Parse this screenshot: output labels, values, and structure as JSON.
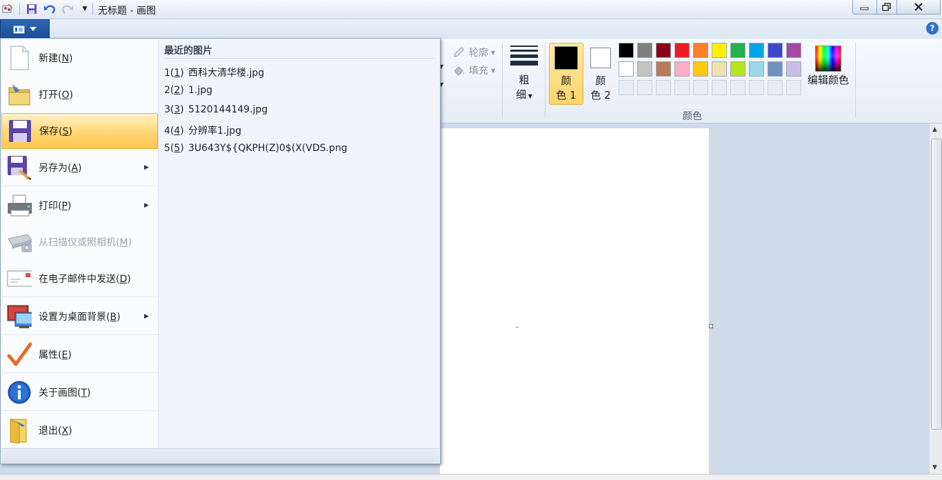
{
  "window": {
    "title": "无标题 - 画图"
  },
  "ribbon": {
    "outline_label": "轮廓",
    "fill_label": "填充",
    "size_label_1": "粗",
    "size_label_2": "细",
    "color1_label_1": "颜",
    "color1_label_2": "色 1",
    "color2_label_1": "颜",
    "color2_label_2": "色 2",
    "edit_colors_label": "编辑颜色",
    "colors_group_label": "颜色",
    "color1_value": "#000000",
    "color2_value": "#ffffff",
    "palette": [
      "#000000",
      "#7f7f7f",
      "#880015",
      "#ed1c24",
      "#ff7f27",
      "#fff200",
      "#22b14c",
      "#00a2e8",
      "#3f48cc",
      "#a349a4",
      "#ffffff",
      "#c3c3c3",
      "#b97a57",
      "#ffaec9",
      "#ffc90e",
      "#efe4b0",
      "#b5e61d",
      "#99d9ea",
      "#7092be",
      "#c8bfe7"
    ]
  },
  "menu": {
    "items": [
      {
        "label": "新建(",
        "key": "N",
        "tail": ")",
        "icon": "new-file-icon"
      },
      {
        "label": "打开(",
        "key": "O",
        "tail": ")",
        "icon": "open-folder-icon"
      },
      {
        "label": "保存(",
        "key": "S",
        "tail": ")",
        "icon": "save-icon"
      },
      {
        "label": "另存为(",
        "key": "A",
        "tail": ")",
        "icon": "save-as-icon"
      },
      {
        "label": "打印(",
        "key": "P",
        "tail": ")",
        "icon": "printer-icon"
      },
      {
        "label": "从扫描仪或照相机(",
        "key": "M",
        "tail": ")",
        "icon": "scanner-icon"
      },
      {
        "label": "在电子邮件中发送(",
        "key": "D",
        "tail": ")",
        "icon": "email-icon"
      },
      {
        "label": "设置为桌面背景(",
        "key": "B",
        "tail": ")",
        "icon": "desktop-background-icon"
      },
      {
        "label": "属性(",
        "key": "E",
        "tail": ")",
        "icon": "properties-check-icon"
      },
      {
        "label": "关于画图(",
        "key": "T",
        "tail": ")",
        "icon": "info-icon"
      },
      {
        "label": "退出(",
        "key": "X",
        "tail": ")",
        "icon": "exit-icon"
      }
    ],
    "recent_header": "最近的图片",
    "recent": [
      {
        "num_a": "1(",
        "num_key": "1",
        "num_b": ")",
        "name": "西科大清华楼.jpg"
      },
      {
        "num_a": "2(",
        "num_key": "2",
        "num_b": ")",
        "name": "1.jpg"
      },
      {
        "num_a": "3(",
        "num_key": "3",
        "num_b": ")",
        "name": "5120144149.jpg"
      },
      {
        "num_a": "4(",
        "num_key": "4",
        "num_b": ")",
        "name": "分辨率1.jpg"
      },
      {
        "num_a": "5(",
        "num_key": "5",
        "num_b": ")",
        "name": "3U643Y${QKPH(Z)0$(X(VDS.png"
      }
    ]
  }
}
